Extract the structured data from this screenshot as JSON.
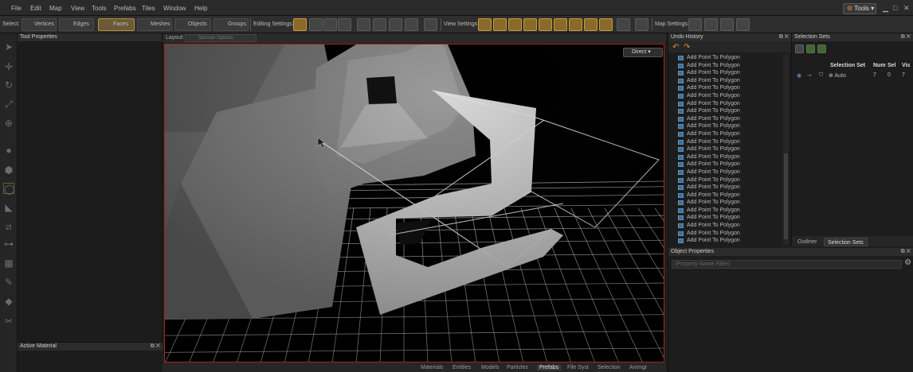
{
  "menu": [
    "File",
    "Edit",
    "Map",
    "View",
    "Tools",
    "Prefabs",
    "Tiles",
    "Window",
    "Help"
  ],
  "tools_button": "Tools",
  "toolbar": {
    "select_label": "Select:",
    "vertices": "Vertices",
    "edges": "Edges",
    "faces": "Faces",
    "meshes": "Meshes",
    "objects": "Objects",
    "groups": "Groups",
    "editing_settings": "Editing Settings:",
    "view_settings": "View Settings:",
    "map_settings": "Map Settings:"
  },
  "tool_properties": {
    "title": "Tool Properties"
  },
  "active_material": {
    "title": "Active Material"
  },
  "viewport": {
    "layout_label": "Layout:",
    "session_options": "Session Options",
    "camera_mode": "Direct",
    "bottom_tabs": [
      "Materials",
      "Entities",
      "Models",
      "Particles",
      "Prefabs",
      "File Syst",
      "Selection",
      "Animgr"
    ],
    "active_tab": "Prefabs"
  },
  "undo_history": {
    "title": "Undo History",
    "items": [
      "Add Point To Polygon",
      "Add Point To Polygon",
      "Add Point To Polygon",
      "Add Point To Polygon",
      "Add Point To Polygon",
      "Add Point To Polygon",
      "Add Point To Polygon",
      "Add Point To Polygon",
      "Add Point To Polygon",
      "Add Point To Polygon",
      "Add Point To Polygon",
      "Add Point To Polygon",
      "Add Point To Polygon",
      "Add Point To Polygon",
      "Add Point To Polygon",
      "Add Point To Polygon",
      "Add Point To Polygon",
      "Add Point To Polygon",
      "Add Point To Polygon",
      "Add Point To Polygon",
      "Add Point To Polygon",
      "Add Point To Polygon",
      "Add Point To Polygon",
      "Add Point To Polygon",
      "Add Point To Polygon"
    ]
  },
  "selection_sets": {
    "title": "Selection Sets",
    "columns": [
      "Selection Set",
      "Num",
      "Sel",
      "Vis"
    ],
    "rows": [
      {
        "name": "Auto",
        "num": "7",
        "sel": "0",
        "vis": "7"
      }
    ],
    "tabs": [
      "Outliner",
      "Selection Sets"
    ],
    "active_tab": "Selection Sets"
  },
  "object_properties": {
    "title": "Object Properties",
    "filter_placeholder": "(Property Name Filter)"
  },
  "colors": {
    "accent": "#c99a3c",
    "viewport_border": "#b02020",
    "grid": "#d8d8d8",
    "undo_icon": "#3c6f9a"
  }
}
